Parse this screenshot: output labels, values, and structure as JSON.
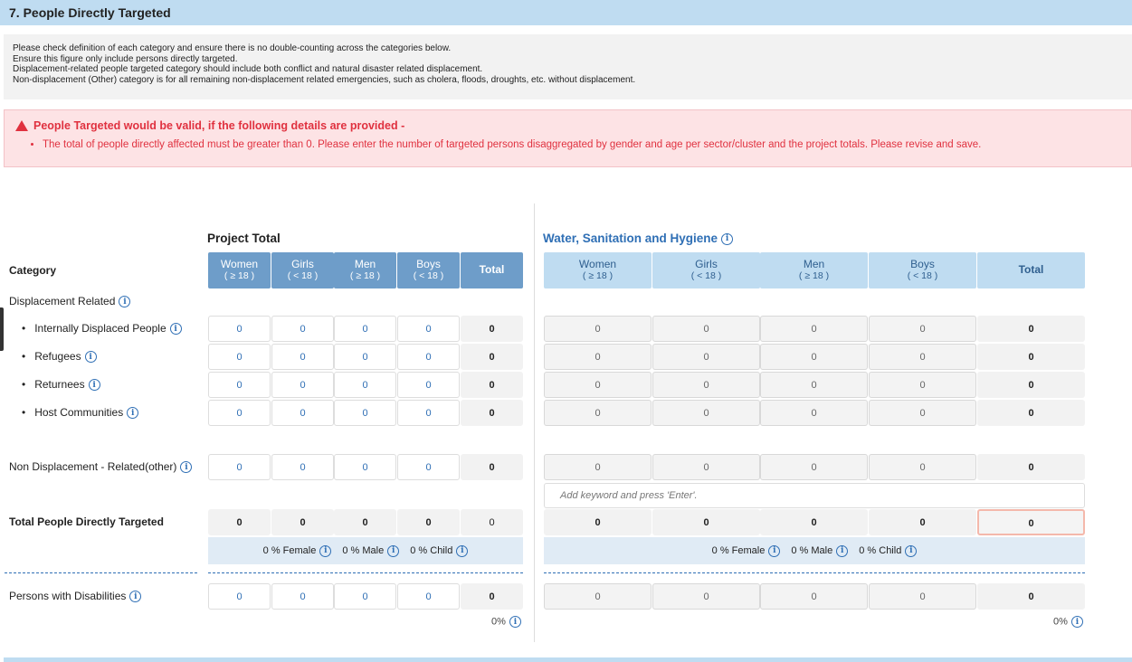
{
  "section_title": "7. People Directly Targeted",
  "info_lines": [
    "Please check definition of each category and ensure there is no double-counting across the categories below.",
    "Ensure this figure only include persons directly targeted.",
    "Displacement-related people targeted category should include both conflict and natural disaster related displacement.",
    "Non-displacement (Other) category is for all remaining non-displacement related emergencies, such as cholera, floods, droughts, etc. without displacement."
  ],
  "alert": {
    "title": "People Targeted would be valid, if the following details are provided -",
    "items": [
      "The total of people directly affected must be greater than 0. Please enter the number of targeted persons disaggregated by gender and age per sector/cluster and the project totals. Please revise and save."
    ]
  },
  "category_header": "Category",
  "project_total_title": "Project Total",
  "cluster_title": "Water, Sanitation and Hygiene",
  "columns": [
    {
      "label": "Women",
      "sub": "( ≥ 18 )"
    },
    {
      "label": "Girls",
      "sub": "( < 18 )"
    },
    {
      "label": "Men",
      "sub": "( ≥ 18 )"
    },
    {
      "label": "Boys",
      "sub": "( < 18 )"
    },
    {
      "label": "Total",
      "sub": ""
    }
  ],
  "displacement_label": "Displacement Related",
  "rows": [
    {
      "label": "Internally Displaced People",
      "project": [
        "0",
        "0",
        "0",
        "0",
        "0"
      ],
      "cluster": [
        "0",
        "0",
        "0",
        "0",
        "0"
      ]
    },
    {
      "label": "Refugees",
      "project": [
        "0",
        "0",
        "0",
        "0",
        "0"
      ],
      "cluster": [
        "0",
        "0",
        "0",
        "0",
        "0"
      ]
    },
    {
      "label": "Returnees",
      "project": [
        "0",
        "0",
        "0",
        "0",
        "0"
      ],
      "cluster": [
        "0",
        "0",
        "0",
        "0",
        "0"
      ]
    },
    {
      "label": "Host Communities",
      "project": [
        "0",
        "0",
        "0",
        "0",
        "0"
      ],
      "cluster": [
        "0",
        "0",
        "0",
        "0",
        "0"
      ]
    }
  ],
  "non_displacement": {
    "label": "Non Displacement - Related(other)",
    "project": [
      "0",
      "0",
      "0",
      "0",
      "0"
    ],
    "cluster": [
      "0",
      "0",
      "0",
      "0",
      "0"
    ]
  },
  "keyword_placeholder": "Add keyword and press 'Enter'.",
  "total": {
    "label": "Total People Directly Targeted",
    "project": [
      "0",
      "0",
      "0",
      "0",
      "0"
    ],
    "cluster": [
      "0",
      "0",
      "0",
      "0",
      "0"
    ]
  },
  "percentages": {
    "female": "0 % Female",
    "male": "0 % Male",
    "child": "0 % Child"
  },
  "disabilities": {
    "label": "Persons with Disabilities",
    "project": [
      "0",
      "0",
      "0",
      "0",
      "0"
    ],
    "cluster": [
      "0",
      "0",
      "0",
      "0",
      "0"
    ],
    "project_pct": "0%",
    "cluster_pct": "0%"
  },
  "colors": {
    "header_bg": "#bfdcf1",
    "project_col_header": "#6e9dc9",
    "cluster_col_header": "#bfdcf1",
    "alert": "#e0313f",
    "accent": "#2f6fb5"
  }
}
